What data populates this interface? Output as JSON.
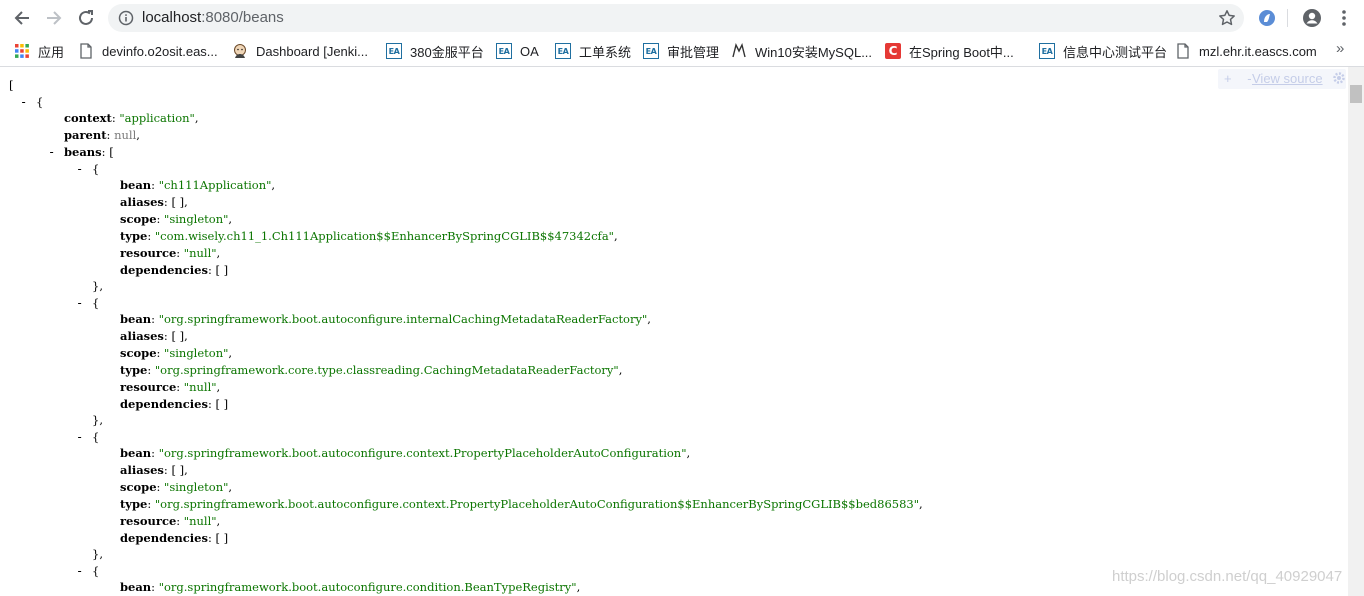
{
  "browser": {
    "url_host": "localhost",
    "url_rest": ":8080/beans",
    "bookmarks": [
      {
        "label": "应用",
        "icon": "apps-grid-icon"
      },
      {
        "label": "devinfo.o2osit.eas...",
        "icon": "page-icon"
      },
      {
        "label": "Dashboard [Jenki...",
        "icon": "jenkins-icon"
      },
      {
        "label": "380金服平台",
        "icon": "ea-logo-icon"
      },
      {
        "label": "OA",
        "icon": "ea-logo-icon"
      },
      {
        "label": "工单系统",
        "icon": "ea-logo-icon"
      },
      {
        "label": "审批管理",
        "icon": "ea-logo-icon"
      },
      {
        "label": "Win10安装MySQL...",
        "icon": "wolf-icon"
      },
      {
        "label": "在Spring Boot中...",
        "icon": "csdn-icon"
      },
      {
        "label": "信息中心测试平台",
        "icon": "ea-logo-icon"
      },
      {
        "label": "mzl.ehr.it.eascs.com",
        "icon": "page-icon"
      }
    ],
    "more": "»"
  },
  "viewer": {
    "view_source": "View source",
    "plus_minus": "+ -",
    "open_bracket": "[",
    "context_key": "context",
    "context_value": "\"application\"",
    "parent_key": "parent",
    "parent_value": "null",
    "beans_key": "beans",
    "beans_open": "[",
    "bean_key": "bean",
    "aliases_key": "aliases",
    "scope_key": "scope",
    "type_key": "type",
    "resource_key": "resource",
    "dependencies_key": "dependencies",
    "beans": [
      {
        "bean": "\"ch111Application\"",
        "aliases": "[ ]",
        "scope": "\"singleton\"",
        "type": "\"com.wisely.ch11_1.Ch111Application$$EnhancerBySpringCGLIB$$47342cfa\"",
        "resource": "\"null\"",
        "dependencies": "[ ]"
      },
      {
        "bean": "\"org.springframework.boot.autoconfigure.internalCachingMetadataReaderFactory\"",
        "aliases": "[ ]",
        "scope": "\"singleton\"",
        "type": "\"org.springframework.core.type.classreading.CachingMetadataReaderFactory\"",
        "resource": "\"null\"",
        "dependencies": "[ ]"
      },
      {
        "bean": "\"org.springframework.boot.autoconfigure.context.PropertyPlaceholderAutoConfiguration\"",
        "aliases": "[ ]",
        "scope": "\"singleton\"",
        "type": "\"org.springframework.boot.autoconfigure.context.PropertyPlaceholderAutoConfiguration$$EnhancerBySpringCGLIB$$bed86583\"",
        "resource": "\"null\"",
        "dependencies": "[ ]"
      },
      {
        "bean": "\"org.springframework.boot.autoconfigure.condition.BeanTypeRegistry\""
      }
    ]
  },
  "watermark": "https://blog.csdn.net/qq_40929047"
}
